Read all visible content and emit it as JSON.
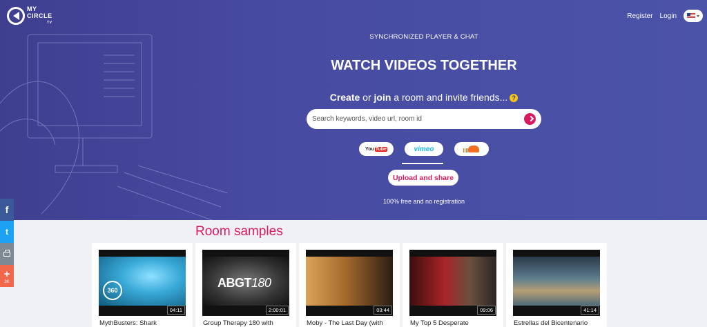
{
  "header": {
    "logo_line1": "MY",
    "logo_line2": "CIRCLE",
    "logo_suffix": "TV",
    "register_label": "Register",
    "login_label": "Login",
    "language_icon": "us-flag-icon"
  },
  "hero": {
    "kicker": "SYNCHRONIZED PLAYER & CHAT",
    "headline": "WATCH VIDEOS TOGETHER",
    "sub_create": "Create",
    "sub_or": " or ",
    "sub_join": "join",
    "sub_rest": " a room and invite friends...",
    "help_glyph": "?",
    "search_placeholder": "Search keywords, video url, room id",
    "providers": [
      "youtube",
      "vimeo",
      "soundcloud"
    ],
    "active_provider": "vimeo",
    "youtube_you": "You",
    "youtube_tube": "Tube",
    "vimeo_label": "vimeo",
    "upload_label": "Upload and share",
    "free_note": "100% free and no registration"
  },
  "share_bar": {
    "facebook_glyph": "f",
    "twitter_glyph": "t",
    "more_glyph": "+",
    "more_count": "3K"
  },
  "samples": {
    "title": "Room samples",
    "items": [
      {
        "title": "MythBusters: Shark",
        "duration": "04:11",
        "overlay": "360"
      },
      {
        "title": "Group Therapy 180 with",
        "duration": "2:00:01",
        "overlay_bold": "ABGT",
        "overlay_light": "180"
      },
      {
        "title": "Moby - The Last Day (with",
        "duration": "03:44"
      },
      {
        "title": "My Top 5 Desperate",
        "duration": "09:06"
      },
      {
        "title": "Estrellas del Bicentenario",
        "duration": "41:14"
      }
    ]
  },
  "colors": {
    "hero_bg": "#474ba2",
    "accent": "#d81b60",
    "facebook": "#3b5998",
    "twitter": "#1da1f2",
    "print": "#7d8a94",
    "more": "#f0674a"
  }
}
